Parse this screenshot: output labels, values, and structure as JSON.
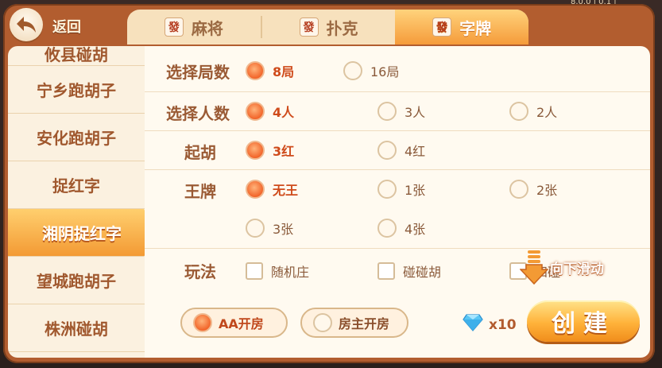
{
  "version": "8.0.0 | 0.1 |",
  "header": {
    "back_label": "返回",
    "tabs": [
      {
        "icon": "mahjong-tile-icon",
        "tile_char": "發",
        "label": "麻将",
        "active": false
      },
      {
        "icon": "mahjong-tile-icon",
        "tile_char": "發",
        "label": "扑克",
        "active": false
      },
      {
        "icon": "mahjong-tile-icon",
        "tile_char": "發",
        "label": "字牌",
        "active": true
      }
    ]
  },
  "sidebar": {
    "items": [
      {
        "label": "攸县碰胡",
        "active": false
      },
      {
        "label": "宁乡跑胡子",
        "active": false
      },
      {
        "label": "安化跑胡子",
        "active": false
      },
      {
        "label": "捉红字",
        "active": false
      },
      {
        "label": "湘阴捉红字",
        "active": true
      },
      {
        "label": "望城跑胡子",
        "active": false
      },
      {
        "label": "株洲碰胡",
        "active": false
      }
    ]
  },
  "options": {
    "rounds": {
      "label": "选择局数",
      "choices": [
        "8局",
        "16局"
      ],
      "selected": "8局"
    },
    "players": {
      "label": "选择人数",
      "choices": [
        "4人",
        "3人",
        "2人"
      ],
      "selected": "4人"
    },
    "qihu": {
      "label": "起胡",
      "choices": [
        "3红",
        "4红"
      ],
      "selected": "3红"
    },
    "wangpai": {
      "label": "王牌",
      "choices": [
        "无王",
        "1张",
        "2张",
        "3张",
        "4张"
      ],
      "selected": "无王"
    },
    "play": {
      "label": "玩法",
      "choices": [
        "随机庄",
        "碰碰胡",
        "四碰"
      ],
      "checked": []
    }
  },
  "scroll_hint": "向下滑动",
  "footer": {
    "payment": [
      {
        "label": "AA开房",
        "selected": true
      },
      {
        "label": "房主开房",
        "selected": false
      }
    ],
    "diamond_cost": "x10",
    "create_label": "创建"
  },
  "colors": {
    "accent": "#f59b3a",
    "selected_text": "#cf4b1b",
    "frame": "#b25d2f"
  }
}
